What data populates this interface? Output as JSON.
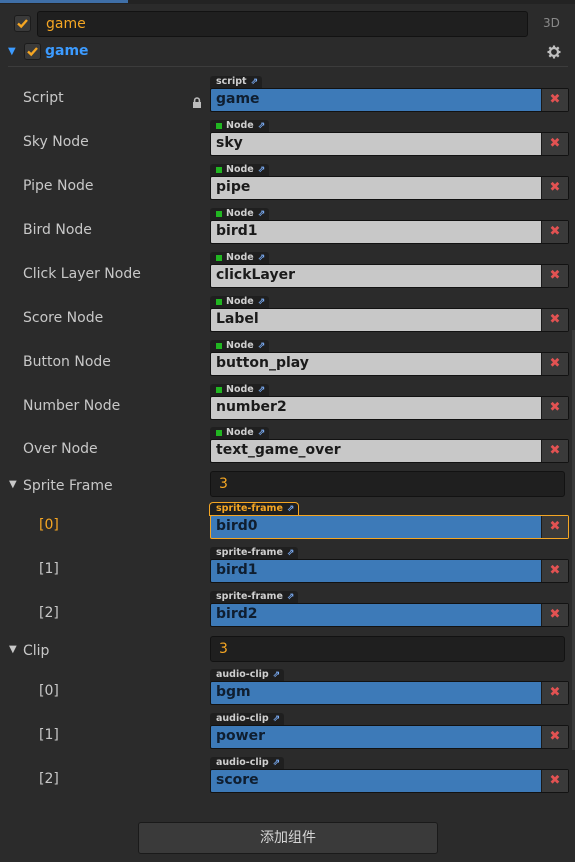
{
  "header": {
    "node_name": "game",
    "mode_tag": "3D",
    "enabled": true
  },
  "component": {
    "title": "game",
    "enabled": true,
    "properties": [
      {
        "label": "Script",
        "type_tag": "script",
        "value": "game",
        "style": "blue",
        "node_dot": false,
        "locked": true
      },
      {
        "label": "Sky Node",
        "type_tag": "Node",
        "value": "sky",
        "style": "gray",
        "node_dot": true
      },
      {
        "label": "Pipe Node",
        "type_tag": "Node",
        "value": "pipe",
        "style": "gray",
        "node_dot": true
      },
      {
        "label": "Bird Node",
        "type_tag": "Node",
        "value": "bird1",
        "style": "gray",
        "node_dot": true
      },
      {
        "label": "Click Layer Node",
        "type_tag": "Node",
        "value": "clickLayer",
        "style": "gray",
        "node_dot": true
      },
      {
        "label": "Score Node",
        "type_tag": "Node",
        "value": "Label",
        "style": "gray",
        "node_dot": true
      },
      {
        "label": "Button Node",
        "type_tag": "Node",
        "value": "button_play",
        "style": "gray",
        "node_dot": true
      },
      {
        "label": "Number Node",
        "type_tag": "Node",
        "value": "number2",
        "style": "gray",
        "node_dot": true
      },
      {
        "label": "Over Node",
        "type_tag": "Node",
        "value": "text_game_over",
        "style": "gray",
        "node_dot": true
      }
    ],
    "arrays": [
      {
        "label": "Sprite Frame",
        "count": "3",
        "items": [
          {
            "index": "[0]",
            "type_tag": "sprite-frame",
            "value": "bird0",
            "selected": true
          },
          {
            "index": "[1]",
            "type_tag": "sprite-frame",
            "value": "bird1",
            "selected": false
          },
          {
            "index": "[2]",
            "type_tag": "sprite-frame",
            "value": "bird2",
            "selected": false
          }
        ]
      },
      {
        "label": "Clip",
        "count": "3",
        "items": [
          {
            "index": "[0]",
            "type_tag": "audio-clip",
            "value": "bgm",
            "selected": false
          },
          {
            "index": "[1]",
            "type_tag": "audio-clip",
            "value": "power",
            "selected": false
          },
          {
            "index": "[2]",
            "type_tag": "audio-clip",
            "value": "score",
            "selected": false
          }
        ]
      }
    ]
  },
  "footer": {
    "add_component_label": "添加组件"
  },
  "icons": {
    "remove": "close-icon",
    "external": "external-link-icon",
    "lock": "lock-icon",
    "settings": "gear-icon",
    "collapse": "triangle-down-icon"
  },
  "colors": {
    "accent": "#f5a623",
    "component_title": "#3c9bff",
    "asset_field": "#3d7ab8",
    "node_field": "#c8c8c8",
    "remove_x": "#e25252",
    "node_dot": "#21b621"
  }
}
